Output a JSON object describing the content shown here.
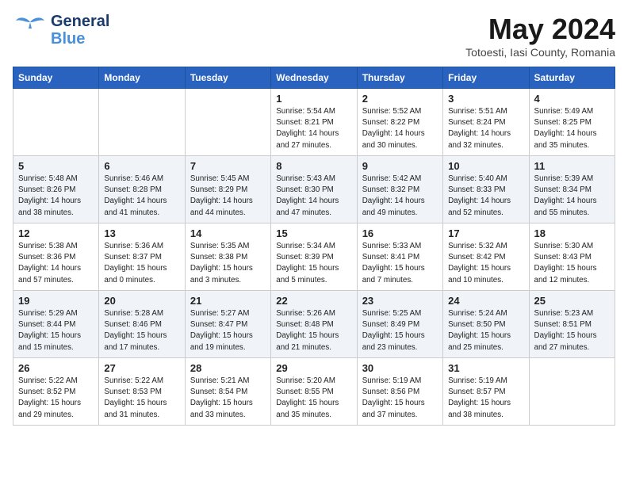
{
  "logo": {
    "general": "General",
    "blue": "Blue"
  },
  "title": "May 2024",
  "location": "Totoesti, Iasi County, Romania",
  "days_of_week": [
    "Sunday",
    "Monday",
    "Tuesday",
    "Wednesday",
    "Thursday",
    "Friday",
    "Saturday"
  ],
  "weeks": [
    [
      {
        "day": null,
        "info": null
      },
      {
        "day": null,
        "info": null
      },
      {
        "day": null,
        "info": null
      },
      {
        "day": "1",
        "info": "Sunrise: 5:54 AM\nSunset: 8:21 PM\nDaylight: 14 hours\nand 27 minutes."
      },
      {
        "day": "2",
        "info": "Sunrise: 5:52 AM\nSunset: 8:22 PM\nDaylight: 14 hours\nand 30 minutes."
      },
      {
        "day": "3",
        "info": "Sunrise: 5:51 AM\nSunset: 8:24 PM\nDaylight: 14 hours\nand 32 minutes."
      },
      {
        "day": "4",
        "info": "Sunrise: 5:49 AM\nSunset: 8:25 PM\nDaylight: 14 hours\nand 35 minutes."
      }
    ],
    [
      {
        "day": "5",
        "info": "Sunrise: 5:48 AM\nSunset: 8:26 PM\nDaylight: 14 hours\nand 38 minutes."
      },
      {
        "day": "6",
        "info": "Sunrise: 5:46 AM\nSunset: 8:28 PM\nDaylight: 14 hours\nand 41 minutes."
      },
      {
        "day": "7",
        "info": "Sunrise: 5:45 AM\nSunset: 8:29 PM\nDaylight: 14 hours\nand 44 minutes."
      },
      {
        "day": "8",
        "info": "Sunrise: 5:43 AM\nSunset: 8:30 PM\nDaylight: 14 hours\nand 47 minutes."
      },
      {
        "day": "9",
        "info": "Sunrise: 5:42 AM\nSunset: 8:32 PM\nDaylight: 14 hours\nand 49 minutes."
      },
      {
        "day": "10",
        "info": "Sunrise: 5:40 AM\nSunset: 8:33 PM\nDaylight: 14 hours\nand 52 minutes."
      },
      {
        "day": "11",
        "info": "Sunrise: 5:39 AM\nSunset: 8:34 PM\nDaylight: 14 hours\nand 55 minutes."
      }
    ],
    [
      {
        "day": "12",
        "info": "Sunrise: 5:38 AM\nSunset: 8:36 PM\nDaylight: 14 hours\nand 57 minutes."
      },
      {
        "day": "13",
        "info": "Sunrise: 5:36 AM\nSunset: 8:37 PM\nDaylight: 15 hours\nand 0 minutes."
      },
      {
        "day": "14",
        "info": "Sunrise: 5:35 AM\nSunset: 8:38 PM\nDaylight: 15 hours\nand 3 minutes."
      },
      {
        "day": "15",
        "info": "Sunrise: 5:34 AM\nSunset: 8:39 PM\nDaylight: 15 hours\nand 5 minutes."
      },
      {
        "day": "16",
        "info": "Sunrise: 5:33 AM\nSunset: 8:41 PM\nDaylight: 15 hours\nand 7 minutes."
      },
      {
        "day": "17",
        "info": "Sunrise: 5:32 AM\nSunset: 8:42 PM\nDaylight: 15 hours\nand 10 minutes."
      },
      {
        "day": "18",
        "info": "Sunrise: 5:30 AM\nSunset: 8:43 PM\nDaylight: 15 hours\nand 12 minutes."
      }
    ],
    [
      {
        "day": "19",
        "info": "Sunrise: 5:29 AM\nSunset: 8:44 PM\nDaylight: 15 hours\nand 15 minutes."
      },
      {
        "day": "20",
        "info": "Sunrise: 5:28 AM\nSunset: 8:46 PM\nDaylight: 15 hours\nand 17 minutes."
      },
      {
        "day": "21",
        "info": "Sunrise: 5:27 AM\nSunset: 8:47 PM\nDaylight: 15 hours\nand 19 minutes."
      },
      {
        "day": "22",
        "info": "Sunrise: 5:26 AM\nSunset: 8:48 PM\nDaylight: 15 hours\nand 21 minutes."
      },
      {
        "day": "23",
        "info": "Sunrise: 5:25 AM\nSunset: 8:49 PM\nDaylight: 15 hours\nand 23 minutes."
      },
      {
        "day": "24",
        "info": "Sunrise: 5:24 AM\nSunset: 8:50 PM\nDaylight: 15 hours\nand 25 minutes."
      },
      {
        "day": "25",
        "info": "Sunrise: 5:23 AM\nSunset: 8:51 PM\nDaylight: 15 hours\nand 27 minutes."
      }
    ],
    [
      {
        "day": "26",
        "info": "Sunrise: 5:22 AM\nSunset: 8:52 PM\nDaylight: 15 hours\nand 29 minutes."
      },
      {
        "day": "27",
        "info": "Sunrise: 5:22 AM\nSunset: 8:53 PM\nDaylight: 15 hours\nand 31 minutes."
      },
      {
        "day": "28",
        "info": "Sunrise: 5:21 AM\nSunset: 8:54 PM\nDaylight: 15 hours\nand 33 minutes."
      },
      {
        "day": "29",
        "info": "Sunrise: 5:20 AM\nSunset: 8:55 PM\nDaylight: 15 hours\nand 35 minutes."
      },
      {
        "day": "30",
        "info": "Sunrise: 5:19 AM\nSunset: 8:56 PM\nDaylight: 15 hours\nand 37 minutes."
      },
      {
        "day": "31",
        "info": "Sunrise: 5:19 AM\nSunset: 8:57 PM\nDaylight: 15 hours\nand 38 minutes."
      },
      {
        "day": null,
        "info": null
      }
    ]
  ]
}
